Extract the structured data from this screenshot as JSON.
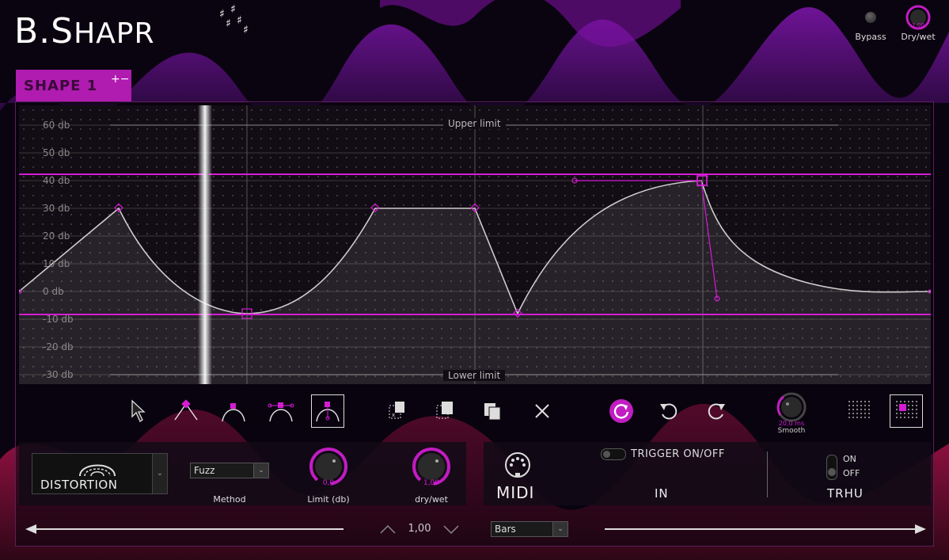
{
  "app": {
    "logo_main": "B.S",
    "logo_rest": "HAPR",
    "sharps": [
      "♯",
      "♯",
      "♯",
      "♯",
      "♯"
    ]
  },
  "header": {
    "bypass_label": "Bypass",
    "drywet_label": "Dry/wet",
    "drywet_value": "1.00"
  },
  "shape_tab": {
    "label": "SHAPE 1",
    "plus_minus": "+−"
  },
  "graph": {
    "y_ticks": [
      "60 db",
      "50 db",
      "40 db",
      "30 db",
      "20 db",
      "10 db",
      "0 db",
      "-10 db",
      "-20 db",
      "-30 db"
    ],
    "upper_limit_label": "Upper limit",
    "lower_limit_label": "Lower limit",
    "accent": "#d41cd4"
  },
  "toolbar": {
    "smooth_value": "20,0 ms",
    "smooth_label": "Smooth"
  },
  "effect": {
    "name": "DISTORTION",
    "method_value": "Fuzz",
    "method_label": "Method",
    "limit_value": "0,0",
    "limit_label": "Limit (db)",
    "drywet_value": "1,00",
    "drywet_label": "dry/wet"
  },
  "midi": {
    "midi_label": "MIDI",
    "trigger_label": "TRIGGER ON/OFF",
    "in_label": "IN",
    "on_label": "ON",
    "off_label": "OFF",
    "thru_label": "TRHU"
  },
  "bottom": {
    "step_value": "1,00",
    "unit_value": "Bars"
  }
}
